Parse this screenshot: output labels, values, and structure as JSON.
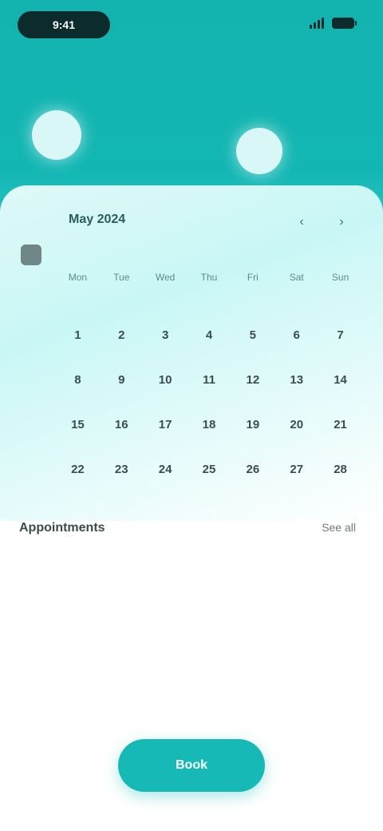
{
  "status_bar": {
    "time": "9:41"
  },
  "calendar": {
    "month_title": "May 2024",
    "legend_text": "",
    "weekdays": [
      "Mon",
      "Tue",
      "Wed",
      "Thu",
      "Fri",
      "Sat",
      "Sun"
    ],
    "weeks": [
      [
        "1",
        "2",
        "3",
        "4",
        "5",
        "6",
        "7"
      ],
      [
        "8",
        "9",
        "10",
        "11",
        "12",
        "13",
        "14"
      ],
      [
        "15",
        "16",
        "17",
        "18",
        "19",
        "20",
        "21"
      ],
      [
        "22",
        "23",
        "24",
        "25",
        "26",
        "27",
        "28"
      ]
    ]
  },
  "sidebar": {
    "label": ""
  },
  "section": {
    "title": "Appointments",
    "action": "See all",
    "subtitle": ""
  },
  "cta": {
    "label": "Book"
  }
}
